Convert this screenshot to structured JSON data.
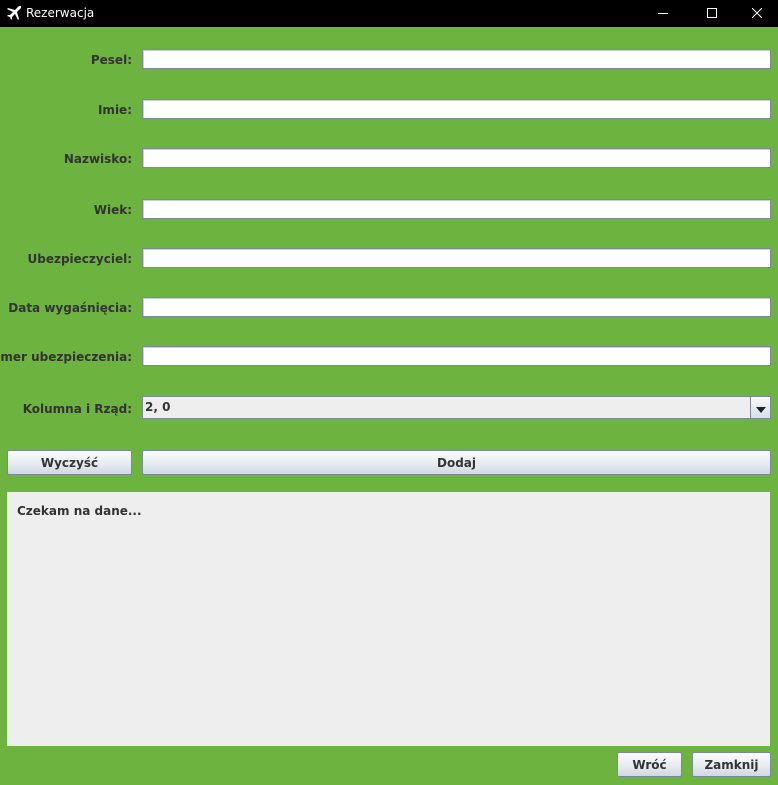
{
  "window": {
    "title": "Rezerwacja",
    "icon": "airplane-icon"
  },
  "form": {
    "fields": [
      {
        "label": "Pesel:",
        "value": ""
      },
      {
        "label": "Imie:",
        "value": ""
      },
      {
        "label": "Nazwisko:",
        "value": ""
      },
      {
        "label": "Wiek:",
        "value": ""
      },
      {
        "label": "Ubezpieczyciel:",
        "value": ""
      },
      {
        "label": "Data wygaśnięcia:",
        "value": ""
      },
      {
        "label": "Numer ubezpieczenia:",
        "value": ""
      }
    ],
    "seat": {
      "label": "Kolumna i Rząd:",
      "selected": "2, 0"
    }
  },
  "actions": {
    "clear_label": "Wyczyść",
    "add_label": "Dodaj"
  },
  "output": {
    "text": "Czekam na dane..."
  },
  "footer": {
    "back_label": "Wróć",
    "close_label": "Zamknij"
  },
  "colors": {
    "background": "#6db33f",
    "titlebar": "#000000",
    "panel": "#eeeeee"
  }
}
